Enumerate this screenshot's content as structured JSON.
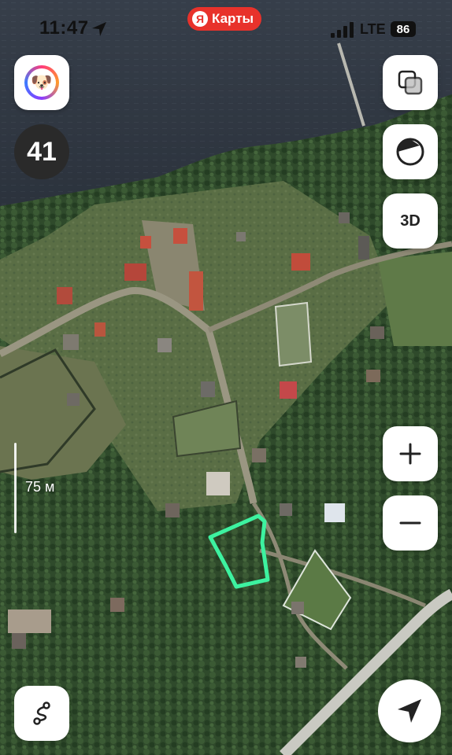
{
  "status_bar": {
    "time": "11:47",
    "network": "LTE",
    "battery": "86"
  },
  "brand": {
    "logo_letter": "Я",
    "name": "Карты",
    "color": "#e8322b"
  },
  "counter_badge": "41",
  "buttons": {
    "three_d": "3D"
  },
  "scale": {
    "label": "75 м"
  },
  "colors": {
    "plot_outline": "#3df2a0",
    "water": "#2c3440",
    "forest": "#2e4a2a"
  }
}
